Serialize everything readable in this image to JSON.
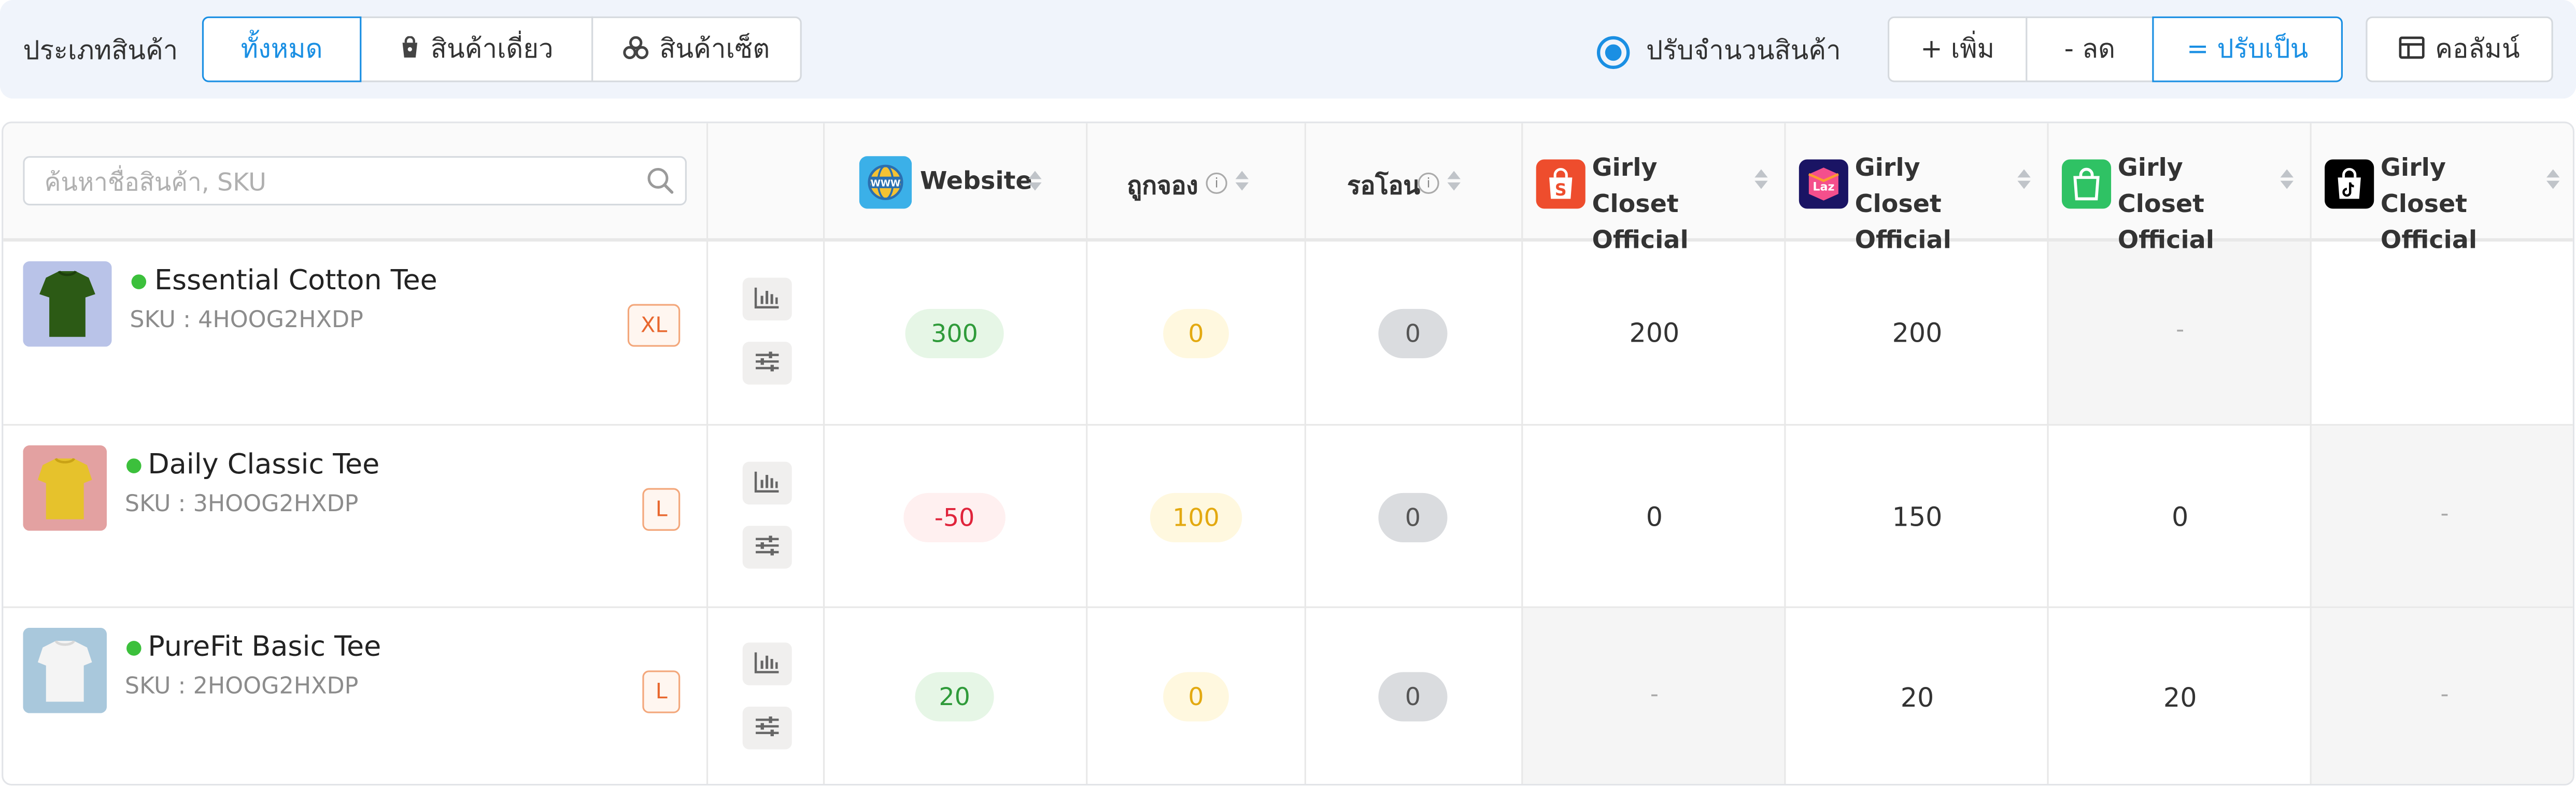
{
  "filter": {
    "label": "ประเภทสินค้า",
    "options": [
      {
        "label": "ทั้งหมด",
        "icon": "none",
        "active": true
      },
      {
        "label": "สินค้าเดี่ยว",
        "icon": "bag-icon",
        "active": false
      },
      {
        "label": "สินค้าเซ็ต",
        "icon": "set-icon",
        "active": false
      }
    ]
  },
  "adjust": {
    "radio_label": "ปรับจำนวนสินค้า",
    "modes": [
      {
        "label": "+ เพิ่ม",
        "active": false
      },
      {
        "label": "- ลด",
        "active": false
      },
      {
        "label": "= ปรับเป็น",
        "active": true
      }
    ],
    "columns_label": "คอลัมน์"
  },
  "search": {
    "placeholder": "ค้นหาชื่อสินค้า, SKU",
    "value": ""
  },
  "headers": {
    "website": "Website",
    "reserved": "ถูกจอง",
    "pending": "รอโอน",
    "shops": [
      {
        "name": "Girly Closet Official",
        "platform": "shopee",
        "color": "#ee4d2d"
      },
      {
        "name": "Girly Closet Official",
        "platform": "lazada",
        "color": "#1a1464"
      },
      {
        "name": "Girly Closet Official",
        "platform": "line-shopping",
        "color": "#2fc264"
      },
      {
        "name": "Girly Closet Official",
        "platform": "tiktok",
        "color": "#000000"
      }
    ]
  },
  "rows": [
    {
      "name": "Essential Cotton Tee",
      "sku": "SKU : 4HOOG2HXDP",
      "size": "XL",
      "status_color": "#3cc03c",
      "thumb_bg": "#b9c3e8",
      "shirt_color": "#2c5a15",
      "website": "300",
      "website_tone": "green",
      "reserved": "0",
      "pending": "0",
      "shops": [
        "200",
        "200",
        "-",
        ""
      ]
    },
    {
      "name": "Daily Classic Tee",
      "sku": "SKU : 3HOOG2HXDP",
      "size": "L",
      "status_color": "#3cc03c",
      "thumb_bg": "#e3a1a1",
      "shirt_color": "#e6c22c",
      "website": "-50",
      "website_tone": "red",
      "reserved": "100",
      "pending": "0",
      "shops": [
        "0",
        "150",
        "0",
        "-"
      ]
    },
    {
      "name": "PureFit Basic Tee",
      "sku": "SKU : 2HOOG2HXDP",
      "size": "L",
      "status_color": "#3cc03c",
      "thumb_bg": "#a9c8dc",
      "shirt_color": "#f4f4f4",
      "website": "20",
      "website_tone": "green",
      "reserved": "0",
      "pending": "0",
      "shops": [
        "-",
        "20",
        "20",
        "-"
      ]
    }
  ],
  "colors": {
    "accent": "#1a8fe3",
    "size_tag": "#e8672e"
  }
}
